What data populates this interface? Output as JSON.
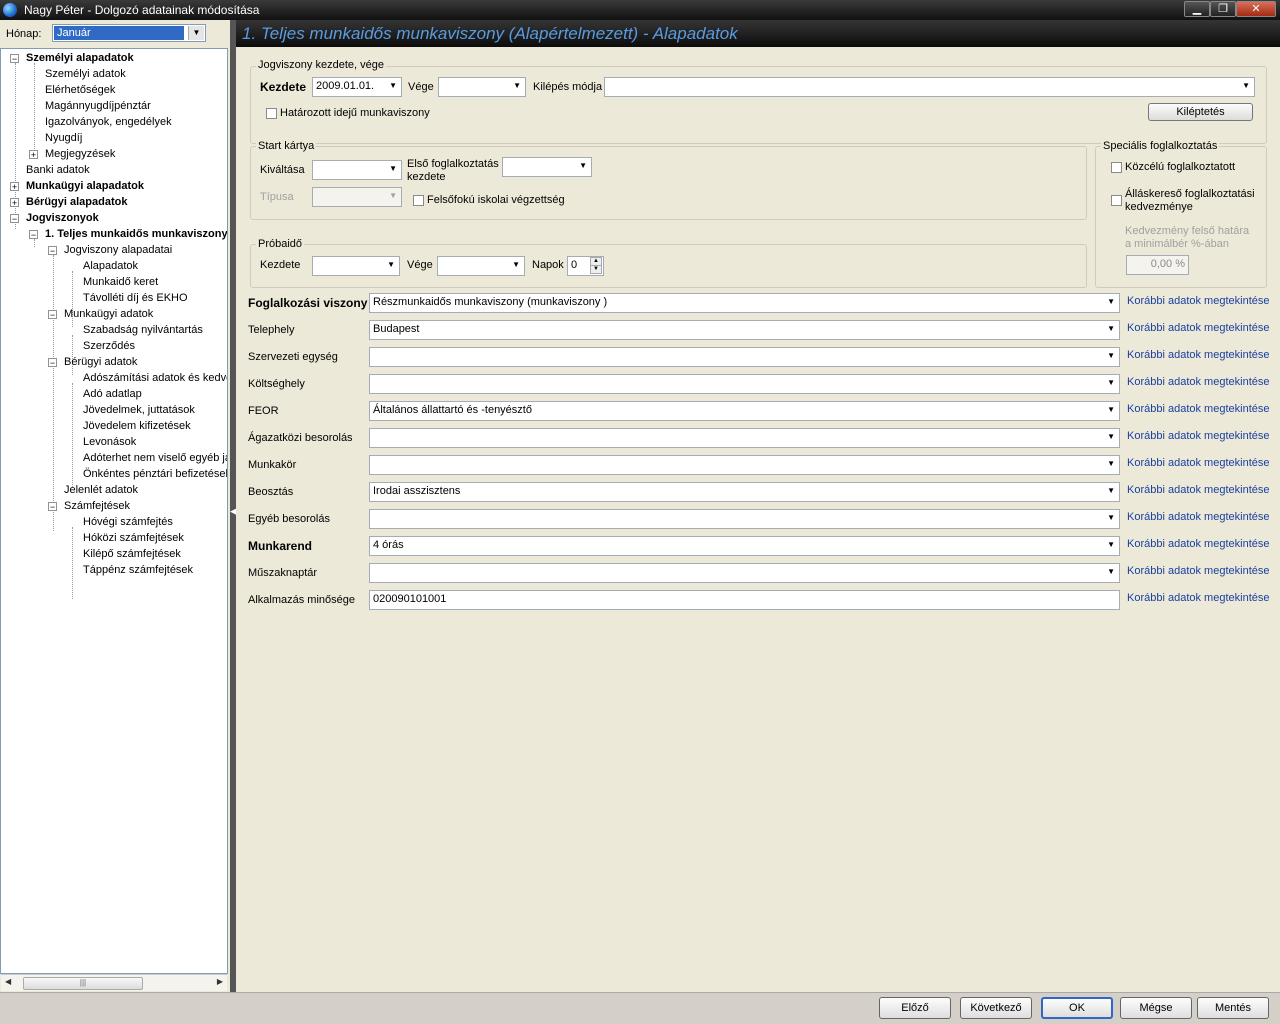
{
  "window": {
    "title": "Nagy Péter - Dolgozó adatainak módosítása",
    "min": "▁",
    "max": "❐",
    "close": "✕"
  },
  "month": {
    "label": "Hónap:",
    "value": "Január"
  },
  "tree": {
    "items": [
      {
        "label": "Személyi alapadatok"
      },
      {
        "label": "Személyi adatok"
      },
      {
        "label": "Elérhetőségek"
      },
      {
        "label": "Magánnyugdíjpénztár"
      },
      {
        "label": "Igazolványok, engedélyek"
      },
      {
        "label": "Nyugdíj"
      },
      {
        "label": "Megjegyzések"
      },
      {
        "label": "Banki adatok"
      },
      {
        "label": "Munkaügyi alapadatok"
      },
      {
        "label": "Bérügyi alapadatok"
      },
      {
        "label": "Jogviszonyok"
      },
      {
        "label": "1. Teljes munkaidős munkaviszony"
      },
      {
        "label": "Jogviszony alapadatai"
      },
      {
        "label": "Alapadatok"
      },
      {
        "label": "Munkaidő keret"
      },
      {
        "label": "Távolléti díj és EKHO"
      },
      {
        "label": "Munkaügyi adatok"
      },
      {
        "label": "Szabadság nyilvántartás"
      },
      {
        "label": "Szerződés"
      },
      {
        "label": "Bérügyi adatok"
      },
      {
        "label": "Adószámítási adatok és kedvezmények"
      },
      {
        "label": "Adó adatlap"
      },
      {
        "label": "Jövedelmek, juttatások"
      },
      {
        "label": "Jövedelem kifizetések"
      },
      {
        "label": "Levonások"
      },
      {
        "label": "Adóterhet nem viselő egyéb járandóságok"
      },
      {
        "label": "Önkéntes pénztári befizetések"
      },
      {
        "label": "Jelenlét adatok"
      },
      {
        "label": "Számfejtések"
      },
      {
        "label": "Hóvégi számfejtés"
      },
      {
        "label": "Hóközi számfejtések"
      },
      {
        "label": "Kilépő számfejtések"
      },
      {
        "label": "Táppénz számfejtések"
      }
    ]
  },
  "header": {
    "title": "1. Teljes munkaidős munkaviszony (Alapértelmezett) - Alapadatok"
  },
  "jogviszony": {
    "group_title": "Jogviszony kezdete, vége",
    "kezdete_label": "Kezdete",
    "kezdete_value": "2009.01.01.",
    "vege_label": "Vége",
    "vege_value": "",
    "kilepes_label": "Kilépés módja",
    "kilepes_value": "",
    "hatarozott_label": "Határozott idejű munkaviszony",
    "kileptetes_button": "Kiléptetés"
  },
  "start_kartya": {
    "group_title": "Start kártya",
    "kivaltasa_label": "Kiváltása",
    "elso_label_1": "Első foglalkoztatás",
    "elso_label_2": "kezdete",
    "tipusa_label": "Típusa",
    "felsofoku_label": "Felsőfokú iskolai végzettség"
  },
  "probaido": {
    "group_title": "Próbaidő",
    "kezdete_label": "Kezdete",
    "vege_label": "Vége",
    "napok_label": "Napok",
    "napok_value": "0"
  },
  "specialis": {
    "group_title": "Speciális foglalkoztatás",
    "kozcelu_label": "Közcélú foglalkoztatott",
    "allaskereso_label_1": "Álláskereső foglalkoztatási",
    "allaskereso_label_2": "kedvezménye",
    "kedvezmeny_label_1": "Kedvezmény felső határa",
    "kedvezmeny_label_2": "a minimálbér %-ában",
    "kedvezmeny_value": "0,00 %"
  },
  "fields": [
    {
      "label": "Foglalkozási viszony",
      "value": "Részmunkaidős munkaviszony (munkaviszony )",
      "link": "Korábbi adatok megtekintése"
    },
    {
      "label": "Telephely",
      "value": "Budapest",
      "link": "Korábbi adatok megtekintése"
    },
    {
      "label": "Szervezeti egység",
      "value": "",
      "link": "Korábbi adatok megtekintése"
    },
    {
      "label": "Költséghely",
      "value": "",
      "link": "Korábbi adatok megtekintése"
    },
    {
      "label": "FEOR",
      "value": "Általános állattartó és -tenyésztő",
      "link": "Korábbi adatok megtekintése"
    },
    {
      "label": "Ágazatközi besorolás",
      "value": "",
      "link": "Korábbi adatok megtekintése"
    },
    {
      "label": "Munkakör",
      "value": "",
      "link": "Korábbi adatok megtekintése"
    },
    {
      "label": "Beosztás",
      "value": "Irodai asszisztens",
      "link": "Korábbi adatok megtekintése"
    },
    {
      "label": "Egyéb besorolás",
      "value": "",
      "link": "Korábbi adatok megtekintése"
    },
    {
      "label": "Munkarend",
      "value": "4 órás",
      "link": "Korábbi adatok megtekintése"
    },
    {
      "label": "Műszaknaptár",
      "value": "",
      "link": "Korábbi adatok megtekintése"
    },
    {
      "label": "Alkalmazás minősége",
      "value": "020090101001",
      "link": "Korábbi adatok megtekintése"
    }
  ],
  "buttons": {
    "elozo": "Előző",
    "kovetkezo": "Következő",
    "ok": "OK",
    "megse": "Mégse",
    "mentes": "Mentés"
  },
  "colors": {
    "header_title": "#5a9be0",
    "link": "#1a3fa0",
    "selection": "#316ac5"
  }
}
